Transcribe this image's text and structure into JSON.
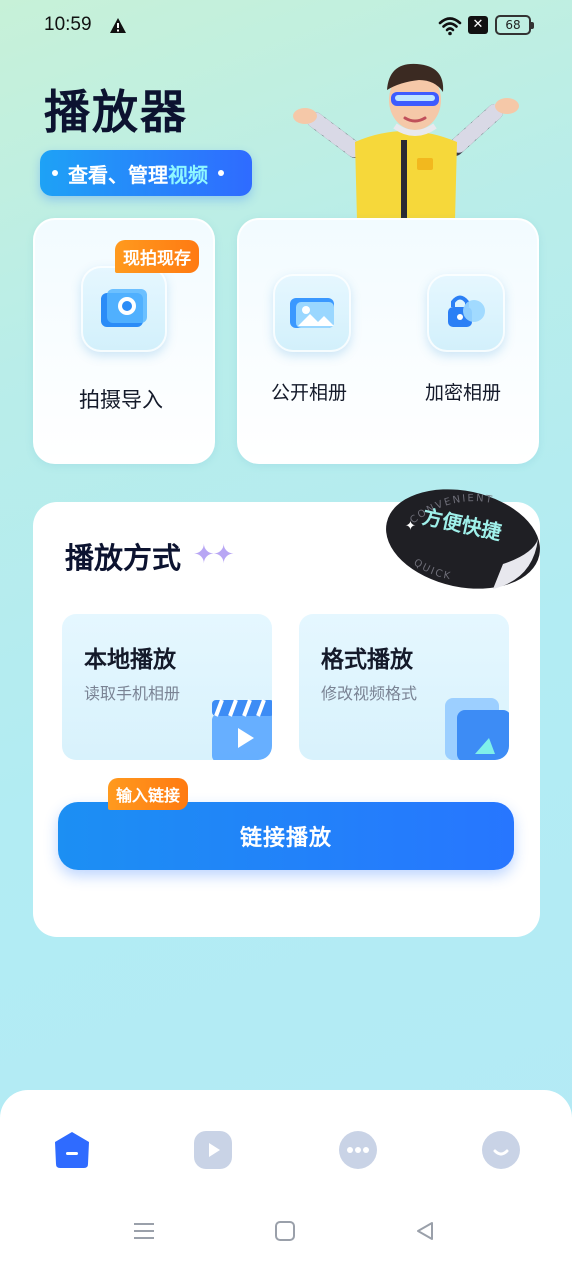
{
  "status_bar": {
    "time": "10:59",
    "battery": "68"
  },
  "header": {
    "title": "播放器",
    "subtitle_prefix": "查看、管理",
    "subtitle_accent": "视频"
  },
  "capture_card": {
    "badge": "现拍现存",
    "label": "拍摄导入"
  },
  "albums_card": {
    "public_label": "公开相册",
    "private_label": "加密相册"
  },
  "play_section": {
    "title": "播放方式",
    "sticker_text": "方便快捷",
    "sticker_en_top": "CONVENIENT",
    "sticker_en_bottom": "QUICK",
    "local": {
      "title": "本地播放",
      "desc": "读取手机相册"
    },
    "format": {
      "title": "格式播放",
      "desc": "修改视频格式"
    },
    "link_badge": "输入链接",
    "link_button": "链接播放"
  },
  "bottom_nav": {
    "active_index": 0,
    "accent": "#2f6bff",
    "inactive": "#c9d3e6"
  },
  "colors": {
    "primary": "#2776ff",
    "orange": "#ff8a1a",
    "title": "#0c1330"
  }
}
